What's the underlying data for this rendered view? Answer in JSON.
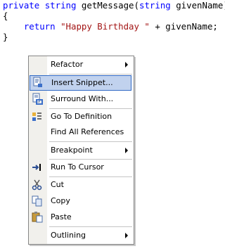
{
  "code": {
    "line1": {
      "kw1": "private",
      "kw2": "string",
      "mid": " getMessage(",
      "kw3": "string",
      "end": " givenName)"
    },
    "line2": "{",
    "line3": {
      "kw": "return",
      "str": "\"Happy Birthday \"",
      "rest": " + givenName;"
    },
    "line4": "}"
  },
  "context_menu": {
    "items": [
      {
        "label": "Refactor",
        "icon": "",
        "submenu": true
      },
      {
        "label": "Insert Snippet...",
        "icon": "snippet-icon",
        "highlighted": true
      },
      {
        "label": "Surround With...",
        "icon": "surround-icon"
      },
      {
        "label": "Go To Definition",
        "icon": "go-to-definition-icon"
      },
      {
        "label": "Find All References",
        "icon": ""
      },
      {
        "label": "Breakpoint",
        "icon": "",
        "submenu": true
      },
      {
        "label": "Run To Cursor",
        "icon": "run-to-cursor-icon"
      },
      {
        "label": "Cut",
        "icon": "scissors-icon"
      },
      {
        "label": "Copy",
        "icon": "copy-icon"
      },
      {
        "label": "Paste",
        "icon": "paste-icon"
      },
      {
        "label": "Outlining",
        "icon": "",
        "submenu": true
      }
    ]
  },
  "colors": {
    "keyword": "#0000ff",
    "string": "#a31515",
    "highlight_bg": "#c1d2ee",
    "highlight_border": "#316ac5"
  }
}
